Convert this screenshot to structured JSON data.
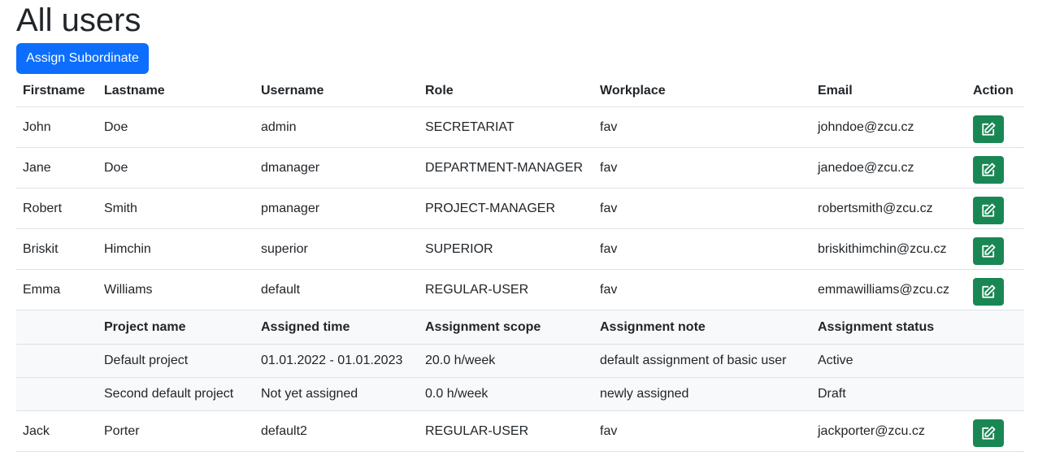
{
  "page": {
    "title": "All users"
  },
  "toolbar": {
    "assign_label": "Assign Subordinate"
  },
  "table": {
    "columns": [
      "Firstname",
      "Lastname",
      "Username",
      "Role",
      "Workplace",
      "Email",
      "Action"
    ],
    "rows": [
      {
        "firstname": "John",
        "lastname": "Doe",
        "username": "admin",
        "role": "SECRETARIAT",
        "workplace": "fav",
        "email": "johndoe@zcu.cz"
      },
      {
        "firstname": "Jane",
        "lastname": "Doe",
        "username": "dmanager",
        "role": "DEPARTMENT-MANAGER",
        "workplace": "fav",
        "email": "janedoe@zcu.cz"
      },
      {
        "firstname": "Robert",
        "lastname": "Smith",
        "username": "pmanager",
        "role": "PROJECT-MANAGER",
        "workplace": "fav",
        "email": "robertsmith@zcu.cz"
      },
      {
        "firstname": "Briskit",
        "lastname": "Himchin",
        "username": "superior",
        "role": "SUPERIOR",
        "workplace": "fav",
        "email": "briskithimchin@zcu.cz"
      },
      {
        "firstname": "Emma",
        "lastname": "Williams",
        "username": "default",
        "role": "REGULAR-USER",
        "workplace": "fav",
        "email": "emmawilliams@zcu.cz"
      },
      {
        "firstname": "Jack",
        "lastname": "Porter",
        "username": "default2",
        "role": "REGULAR-USER",
        "workplace": "fav",
        "email": "jackporter@zcu.cz"
      }
    ],
    "action_icon": "edit-icon",
    "action_color": "#198754"
  },
  "assignments": {
    "columns": [
      "Project name",
      "Assigned time",
      "Assignment scope",
      "Assignment note",
      "Assignment status"
    ],
    "rows": [
      {
        "project": "Default project",
        "time": "01.01.2022 - 01.01.2023",
        "scope": "20.0 h/week",
        "note": "default assignment of basic user",
        "status": "Active"
      },
      {
        "project": "Second default project",
        "time": "Not yet assigned",
        "scope": "0.0 h/week",
        "note": "newly assigned",
        "status": "Draft"
      }
    ]
  },
  "colors": {
    "primary": "#0d6efd",
    "success": "#198754",
    "expanded_bg": "#f8f9fa"
  }
}
